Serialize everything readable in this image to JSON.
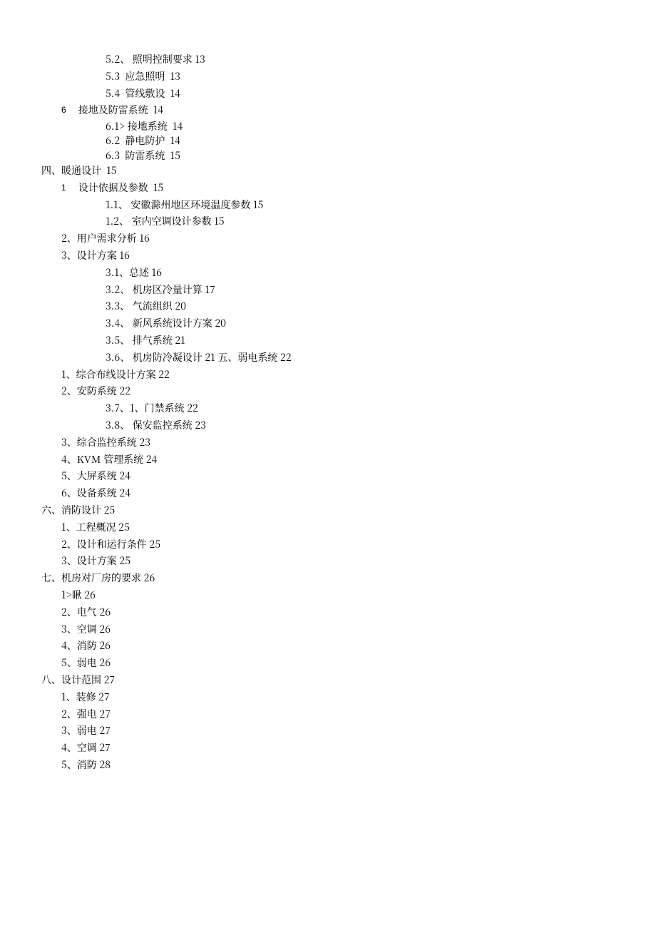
{
  "toc": {
    "group_a": {
      "i52": "5.2、 照明控制要求 13",
      "i53": "5.3  应急照明  13",
      "i54": "5.4  管线敷设  14"
    },
    "group_b": {
      "num": "6",
      "head": "接地及防雷系统  14",
      "i61": "6.1> 接地系统  14",
      "i62": "6.2  静电防护  14",
      "i63": "6.3  防雷系统  15"
    },
    "sec4": {
      "head": "四、暖通设计  15",
      "num1": "1",
      "s1": "设计依据及参数  15",
      "i11": "1.1、 安徽滁州地区环境温度参数 15",
      "i12": "1.2、 室内空调设计参数 15",
      "s2": "2、用户需求分析 16",
      "s3": "3、设计方案 16",
      "i31": "3.1、总述 16",
      "i32": "3.2、 机房区冷量计算 17",
      "i33": "3.3、 气流组织 20",
      "i34": "3.4、 新风系统设计方案 20",
      "i35": "3.5、 排气系统 21",
      "i36": "3.6、 机房防冷凝设计 21 五、弱电系统 22",
      "s1b": "1、综合布线设计方案 22",
      "s2b": "2、安防系统 22",
      "i37": "3.7、1、门禁系统 22",
      "i38": "3.8、 保安监控系统 23",
      "s3b": "3、综合监控系统 23",
      "s4": "4、KVM 管理系统 24",
      "s5": "5、大屏系统 24",
      "s6": "6、设备系统 24"
    },
    "sec6": {
      "head": "六、消防设计 25",
      "s1": "1、工程概况 25",
      "s2": "2、设计和运行条件 25",
      "s3": "3、设计方案 25"
    },
    "sec7": {
      "head": "七、机房对厂房的要求 26",
      "s1": "1>瞅 26",
      "s2": "2、电气 26",
      "s3": "3、空调 26",
      "s4": "4、消防 26",
      "s5": "5、弱电 26"
    },
    "sec8": {
      "head": "八、设计范围 27",
      "s1": "1、装修 27",
      "s2": "2、强电 27",
      "s3": "3、弱电 27",
      "s4": "4、空调 27",
      "s5": "5、消防 28"
    }
  }
}
